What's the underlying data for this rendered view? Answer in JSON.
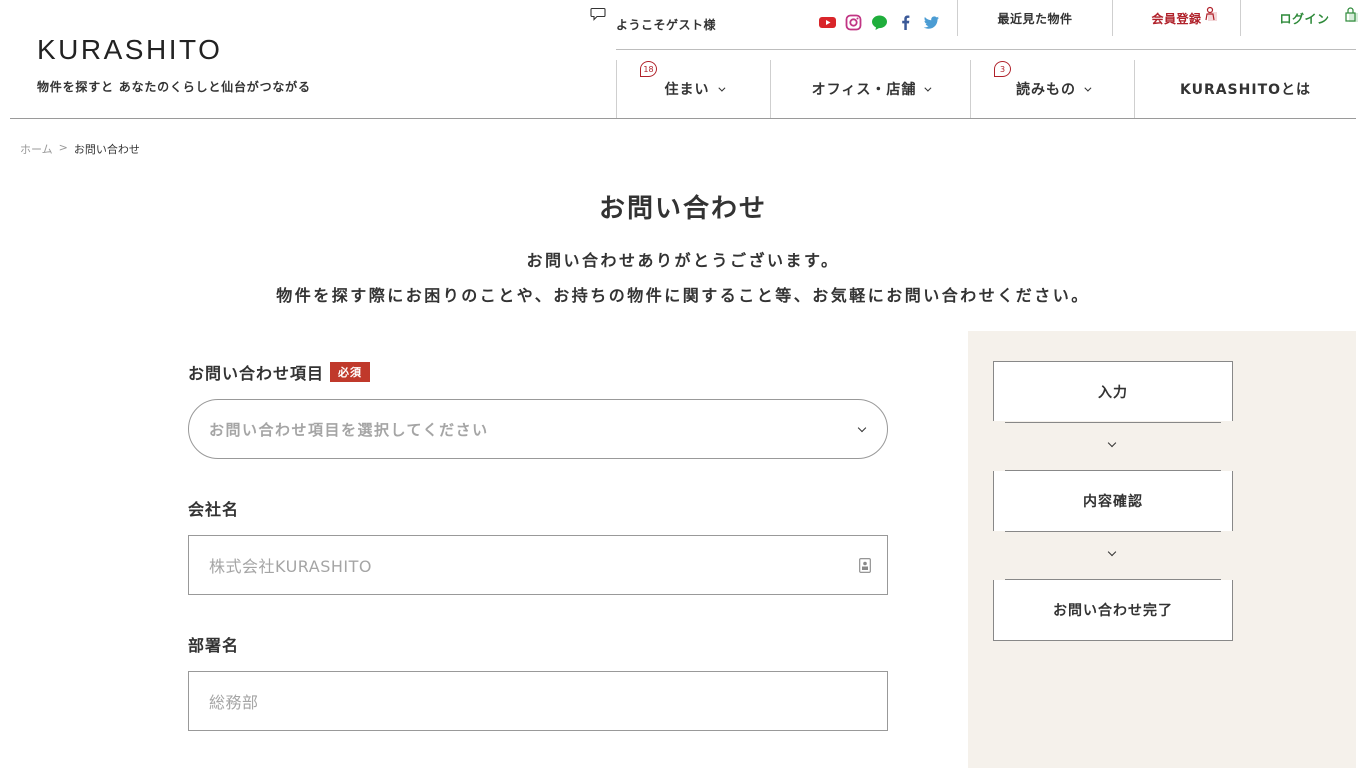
{
  "header": {
    "logo": "KURASHITO",
    "tagline": "物件を探すと あなたのくらしと仙台がつながる",
    "welcome": "ようこそゲスト様",
    "social": [
      "youtube-icon",
      "instagram-icon",
      "line-icon",
      "facebook-icon",
      "twitter-icon"
    ],
    "top_links": {
      "recent": "最近見た物件",
      "register": "会員登録",
      "login": "ログイン"
    },
    "nav": [
      {
        "label": "住まい",
        "badge": "18"
      },
      {
        "label": "オフィス・店舗",
        "badge": ""
      },
      {
        "label": "読みもの",
        "badge": "3"
      },
      {
        "label": "KURASHITOとは",
        "badge": ""
      }
    ]
  },
  "breadcrumb": {
    "home": "ホーム",
    "separator": ">",
    "current": "お問い合わせ"
  },
  "page": {
    "title": "お問い合わせ",
    "intro_line1": "お問い合わせありがとうございます。",
    "intro_line2": "物件を探す際にお困りのことや、お持ちの物件に関すること等、お気軽にお問い合わせください。"
  },
  "form": {
    "inquiry_type": {
      "label": "お問い合わせ項目",
      "required": "必須",
      "placeholder": "お問い合わせ項目を選択してください"
    },
    "company": {
      "label": "会社名",
      "placeholder": "株式会社KURASHITO"
    },
    "department": {
      "label": "部署名",
      "placeholder": "総務部"
    }
  },
  "steps": [
    "入力",
    "内容確認",
    "お問い合わせ完了"
  ],
  "colors": {
    "accent_red": "#b0212a",
    "accent_green": "#2e8a3a",
    "panel_bg": "#f5f1eb"
  }
}
